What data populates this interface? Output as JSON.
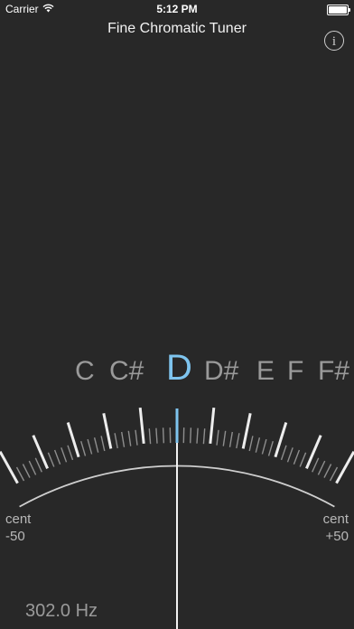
{
  "status_bar": {
    "carrier": "Carrier",
    "wifi_icon": "wifi-icon",
    "time": "5:12 PM",
    "battery_icon": "battery-icon"
  },
  "header": {
    "title": "Fine Chromatic Tuner",
    "info_icon": "info-icon",
    "info_glyph": "i"
  },
  "notes": [
    "C",
    "C#",
    "D",
    "D#",
    "E",
    "F",
    "F#"
  ],
  "selected_note_index": 2,
  "meter": {
    "left_label": "cent",
    "left_value": "-50",
    "right_label": "cent",
    "right_value": "+50",
    "needle_cents": 0
  },
  "frequency": "302.0 Hz",
  "colors": {
    "background": "#282828",
    "accent": "#7ec4ee",
    "note_inactive": "#9a9a9a",
    "tick": "#e6e6e6"
  }
}
